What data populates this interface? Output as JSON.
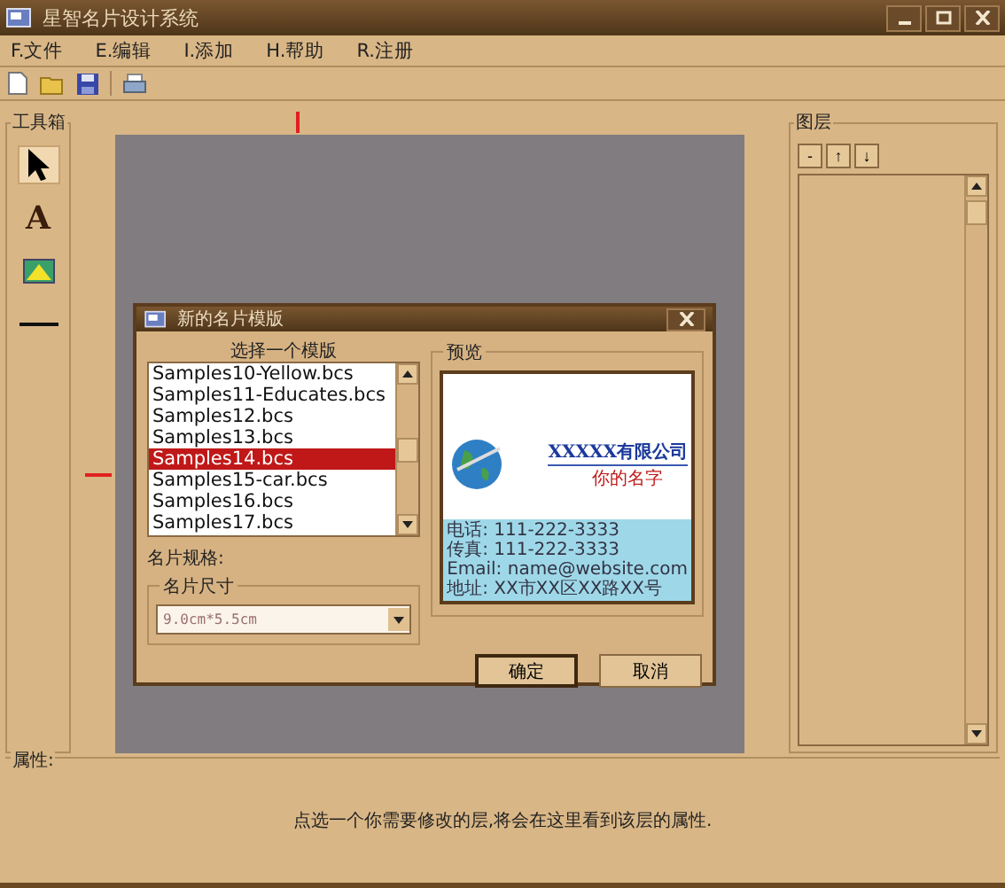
{
  "window": {
    "title": "星智名片设计系统"
  },
  "menu": [
    {
      "label": "F.文件"
    },
    {
      "label": "E.编辑"
    },
    {
      "label": "I.添加"
    },
    {
      "label": "H.帮助"
    },
    {
      "label": "R.注册"
    }
  ],
  "toolbar": [
    {
      "kind": "new"
    },
    {
      "kind": "open"
    },
    {
      "kind": "save"
    },
    {
      "kind": "separator"
    },
    {
      "kind": "print"
    }
  ],
  "toolbox": {
    "title": "工具箱",
    "tools": [
      {
        "kind": "pointer",
        "selected": true
      },
      {
        "kind": "text",
        "label": "A",
        "selected": false
      },
      {
        "kind": "image",
        "selected": false
      },
      {
        "kind": "line",
        "selected": false
      }
    ]
  },
  "layers": {
    "title": "图层",
    "buttons": [
      "-",
      "↑",
      "↓"
    ]
  },
  "dialog": {
    "title": "新的名片模版",
    "list_title": "选择一个模版",
    "templates": [
      {
        "name": "Samples10-Yellow.bcs",
        "selected": false
      },
      {
        "name": "Samples11-Educates.bcs",
        "selected": false
      },
      {
        "name": "Samples12.bcs",
        "selected": false
      },
      {
        "name": "Samples13.bcs",
        "selected": false
      },
      {
        "name": "Samples14.bcs",
        "selected": true
      },
      {
        "name": "Samples15-car.bcs",
        "selected": false
      },
      {
        "name": "Samples16.bcs",
        "selected": false
      },
      {
        "name": "Samples17.bcs",
        "selected": false
      }
    ],
    "spec_label": "名片规格:",
    "size_group": "名片尺寸",
    "size_value": "9.0cm*5.5cm",
    "preview_title": "预览",
    "card": {
      "company": "XXXXX有限公司",
      "person": "你的名字",
      "lines": [
        "电话: 111-222-3333",
        "传真: 111-222-3333",
        "Email: name@website.com",
        "地址: XX市XX区XX路XX号"
      ]
    },
    "buttons": [
      {
        "label": "确定",
        "default": true
      },
      {
        "label": "取消",
        "default": false
      }
    ]
  },
  "properties": {
    "title": "属性:",
    "hint": "点选一个你需要修改的层,将会在这里看到该层的属性."
  }
}
